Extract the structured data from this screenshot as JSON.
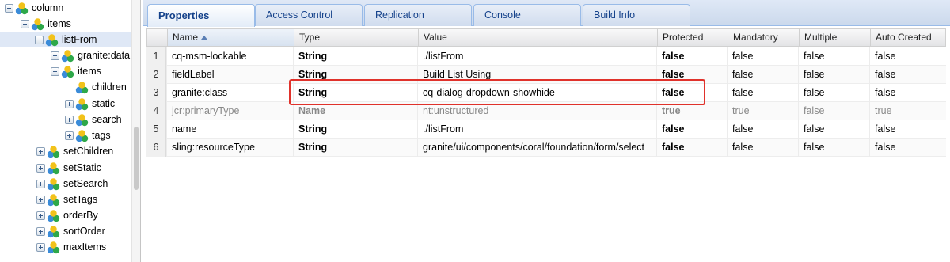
{
  "tree": {
    "nodes": [
      {
        "label": "column",
        "expander": "minus"
      },
      {
        "label": "items",
        "expander": "minus"
      },
      {
        "label": "listFrom",
        "expander": "minus"
      },
      {
        "label": "granite:data",
        "expander": "plus"
      },
      {
        "label": "items",
        "expander": "minus"
      },
      {
        "label": "children",
        "expander": "none"
      },
      {
        "label": "static",
        "expander": "plus"
      },
      {
        "label": "search",
        "expander": "plus"
      },
      {
        "label": "tags",
        "expander": "plus"
      },
      {
        "label": "setChildren",
        "expander": "plus"
      },
      {
        "label": "setStatic",
        "expander": "plus"
      },
      {
        "label": "setSearch",
        "expander": "plus"
      },
      {
        "label": "setTags",
        "expander": "plus"
      },
      {
        "label": "orderBy",
        "expander": "plus"
      },
      {
        "label": "sortOrder",
        "expander": "plus"
      },
      {
        "label": "maxItems",
        "expander": "plus"
      }
    ]
  },
  "tabs": [
    {
      "label": "Properties",
      "active": true
    },
    {
      "label": "Access Control",
      "active": false
    },
    {
      "label": "Replication",
      "active": false
    },
    {
      "label": "Console",
      "active": false
    },
    {
      "label": "Build Info",
      "active": false
    }
  ],
  "grid": {
    "columns": [
      "Name",
      "Type",
      "Value",
      "Protected",
      "Mandatory",
      "Multiple",
      "Auto Created"
    ],
    "sort_column": "Name",
    "rows": [
      {
        "num": "1",
        "name": "cq-msm-lockable",
        "type": "String",
        "value": "./listFrom",
        "protected": "false",
        "mandatory": "false",
        "multiple": "false",
        "auto_created": "false"
      },
      {
        "num": "2",
        "name": "fieldLabel",
        "type": "String",
        "value": "Build List Using",
        "protected": "false",
        "mandatory": "false",
        "multiple": "false",
        "auto_created": "false"
      },
      {
        "num": "3",
        "name": "granite:class",
        "type": "String",
        "value": "cq-dialog-dropdown-showhide",
        "protected": "false",
        "mandatory": "false",
        "multiple": "false",
        "auto_created": "false"
      },
      {
        "num": "4",
        "name": "jcr:primaryType",
        "type": "Name",
        "value": "nt:unstructured",
        "protected": "true",
        "mandatory": "true",
        "multiple": "false",
        "auto_created": "true"
      },
      {
        "num": "5",
        "name": "name",
        "type": "String",
        "value": "./listFrom",
        "protected": "false",
        "mandatory": "false",
        "multiple": "false",
        "auto_created": "false"
      },
      {
        "num": "6",
        "name": "sling:resourceType",
        "type": "String",
        "value": "granite/ui/components/coral/foundation/form/select",
        "protected": "false",
        "mandatory": "false",
        "multiple": "false",
        "auto_created": "false"
      }
    ]
  },
  "colors": {
    "highlight": "#e0322b",
    "tab_text": "#15428b",
    "selected_node": "#dfe8f6"
  }
}
